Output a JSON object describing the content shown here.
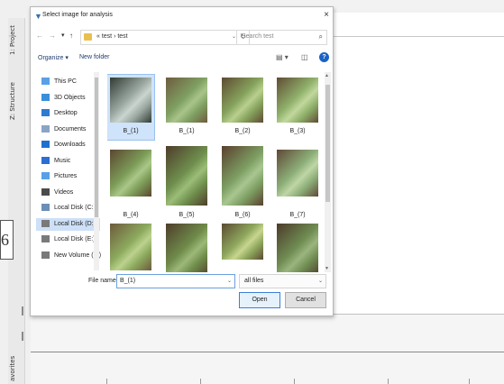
{
  "ide": {
    "tabs": [
      "1: Project",
      "Z: Structure",
      "avorites"
    ],
    "editor_digit": "6"
  },
  "dialog": {
    "title": "Select image for analysis",
    "close": "×",
    "nav": {
      "back": "←",
      "forward": "→",
      "up": "↑"
    },
    "address": "« test › test",
    "search_placeholder": "Search test",
    "toolbar": {
      "organize": "Organize ▾",
      "new_folder": "New folder"
    },
    "nav_items": [
      {
        "label": "This PC",
        "icon": "computer-icon",
        "color": "#5aa0e6"
      },
      {
        "label": "3D Objects",
        "icon": "cube-icon",
        "color": "#3b8fd9"
      },
      {
        "label": "Desktop",
        "icon": "desktop-icon",
        "color": "#2d7bd2"
      },
      {
        "label": "Documents",
        "icon": "document-icon",
        "color": "#8aa4c6"
      },
      {
        "label": "Downloads",
        "icon": "download-icon",
        "color": "#1f6fd1"
      },
      {
        "label": "Music",
        "icon": "music-icon",
        "color": "#2b6fd2"
      },
      {
        "label": "Pictures",
        "icon": "picture-icon",
        "color": "#5aa0e6"
      },
      {
        "label": "Videos",
        "icon": "video-icon",
        "color": "#4b4b4b"
      },
      {
        "label": "Local Disk (C:)",
        "icon": "disk-icon",
        "color": "#6b8fb8"
      },
      {
        "label": "Local Disk (D:)",
        "icon": "disk-icon",
        "color": "#7a7a7a"
      },
      {
        "label": "Local Disk (E:)",
        "icon": "disk-icon",
        "color": "#7a7a7a"
      },
      {
        "label": "New Volume (F:)",
        "icon": "disk-icon",
        "color": "#7a7a7a"
      }
    ],
    "selected_nav": "Local Disk (D:)",
    "files": [
      {
        "name": "B_(1)",
        "colors": [
          "#2f3b33",
          "#9aa6a0",
          "#c9d5ce"
        ]
      },
      {
        "name": "B_(1)",
        "colors": [
          "#6e5b3e",
          "#7fa062",
          "#a9c48a"
        ]
      },
      {
        "name": "B_(2)",
        "colors": [
          "#5e4a32",
          "#86a35d",
          "#b9cf8e"
        ]
      },
      {
        "name": "B_(3)",
        "colors": [
          "#604b35",
          "#8fb06a",
          "#c2d89d"
        ]
      },
      {
        "name": "B_(4)",
        "colors": [
          "#5b4630",
          "#7c9c58",
          "#aac788"
        ]
      },
      {
        "name": "B_(5)",
        "colors": [
          "#4e3c2a",
          "#6f8f4e",
          "#9bbd77"
        ]
      },
      {
        "name": "B_(6)",
        "colors": [
          "#5a3f2e",
          "#7d9f63",
          "#a9c691"
        ]
      },
      {
        "name": "B_(7)",
        "colors": [
          "#5f4836",
          "#8cae78",
          "#bfd6a5"
        ]
      },
      {
        "name": "",
        "colors": [
          "#6d5a3c",
          "#8caa5e",
          "#bcd28e"
        ]
      },
      {
        "name": "",
        "colors": [
          "#4e3d2b",
          "#6f8b4a",
          "#9db878"
        ]
      },
      {
        "name": "",
        "colors": [
          "#5b4a33",
          "#8fa75d",
          "#c8d68f"
        ]
      },
      {
        "name": "",
        "colors": [
          "#4b3a2a",
          "#6f8c52",
          "#9ab57e"
        ]
      }
    ],
    "file_name_label": "File name:",
    "file_name_value": "B_(1)",
    "file_type": "all files",
    "open_label": "Open",
    "cancel_label": "Cancel"
  }
}
